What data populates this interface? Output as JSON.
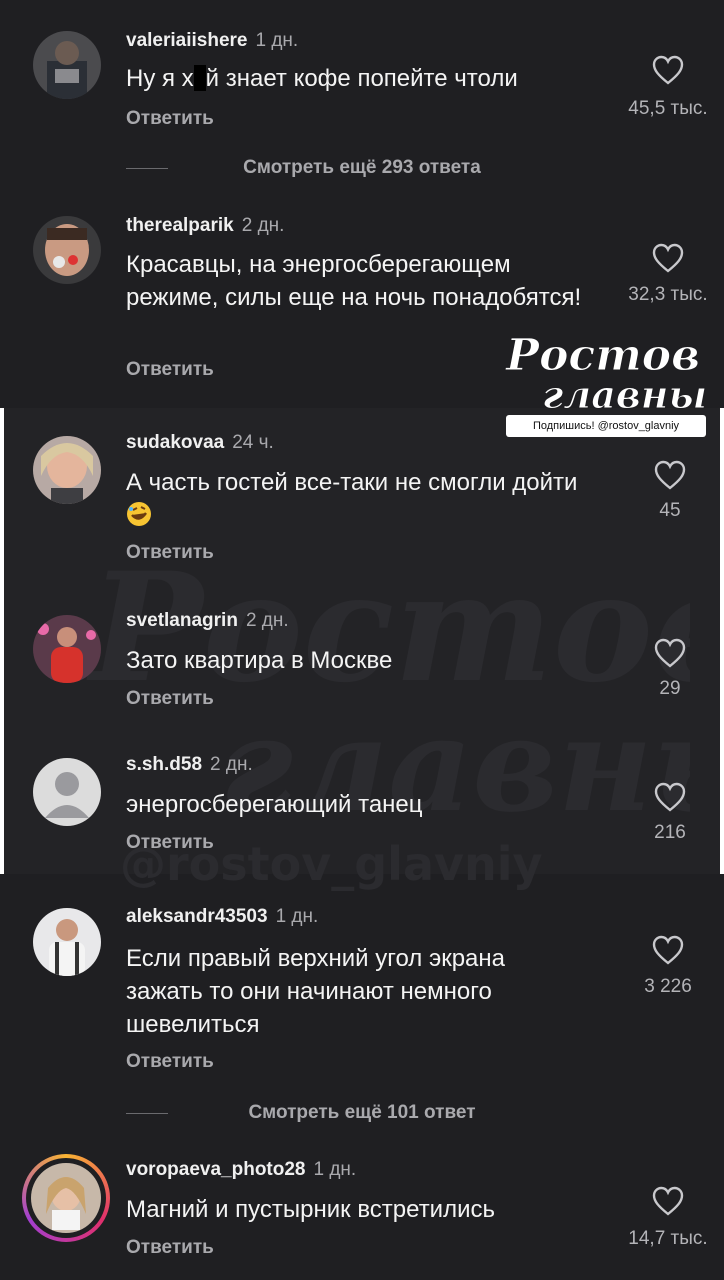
{
  "comments": [
    {
      "user": "valeriaiishere",
      "time": "1 дн.",
      "text_pre": "Ну я х",
      "text_post": "й знает кофе попейте чтоли",
      "reply": "Ответить",
      "likes": "45,5 тыс."
    },
    {
      "user": "therealparik",
      "time": "2 дн.",
      "text": "Красавцы, на энергосберегающем режиме, силы еще на ночь понадобятся!",
      "reply": "Ответить",
      "likes": "32,3 тыс."
    },
    {
      "user": "sudakovaa",
      "time": "24 ч.",
      "text": "А часть гостей все-таки не смогли дойти",
      "reply": "Ответить",
      "likes": "45"
    },
    {
      "user": "svetlanagrin",
      "time": "2 дн.",
      "text": "Зато квартира в Москве",
      "reply": "Ответить",
      "likes": "29"
    },
    {
      "user": "s.sh.d58",
      "time": "2 дн.",
      "text": "энергосберегающий танец",
      "reply": "Ответить",
      "likes": "216"
    },
    {
      "user": "aleksandr43503",
      "time": "1 дн.",
      "text": "Если правый верхний угол экрана зажать то они начинают немного шевелиться",
      "reply": "Ответить",
      "likes": "3 226"
    },
    {
      "user": "voropaeva_photo28",
      "time": "1 дн.",
      "text": "Магний и пустырник встретились",
      "reply": "Ответить",
      "likes": "14,7 тыс."
    }
  ],
  "more_replies": [
    {
      "label": "Смотреть ещё 293 ответа"
    },
    {
      "label": "Смотреть ещё 101 ответ"
    }
  ],
  "watermark": {
    "logo_line1": "Ростов",
    "logo_line2": "главный",
    "subscribe": "Подпишись! @rostov_glavniy"
  },
  "icons": {
    "like": "heart-outline-icon",
    "emoji": "rolling-on-floor-laughing-emoji"
  },
  "colors": {
    "background": "#1f1f22",
    "text": "#f4f4f4",
    "secondary": "#a9a9ad"
  }
}
